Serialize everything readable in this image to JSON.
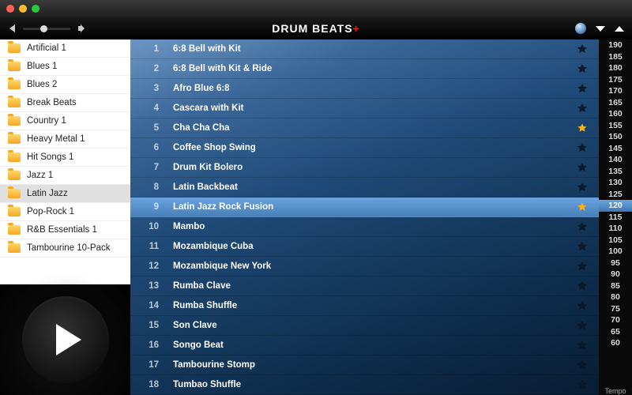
{
  "app": {
    "title": "DRUM BEATS",
    "title_suffix": "+"
  },
  "sidebar": {
    "folders": [
      {
        "label": "Artificial 1",
        "selected": false
      },
      {
        "label": "Blues 1",
        "selected": false
      },
      {
        "label": "Blues 2",
        "selected": false
      },
      {
        "label": "Break Beats",
        "selected": false
      },
      {
        "label": "Country 1",
        "selected": false
      },
      {
        "label": "Heavy Metal 1",
        "selected": false
      },
      {
        "label": "Hit Songs 1",
        "selected": false
      },
      {
        "label": "Jazz 1",
        "selected": false
      },
      {
        "label": "Latin Jazz",
        "selected": true
      },
      {
        "label": "Pop-Rock 1",
        "selected": false
      },
      {
        "label": "R&B Essentials 1",
        "selected": false
      },
      {
        "label": "Tambourine 10-Pack",
        "selected": false
      }
    ]
  },
  "tracks": [
    {
      "n": "1",
      "name": "6:8 Bell with Kit",
      "fav": false,
      "selected": false
    },
    {
      "n": "2",
      "name": "6:8 Bell with Kit & Ride",
      "fav": false,
      "selected": false
    },
    {
      "n": "3",
      "name": "Afro Blue 6:8",
      "fav": false,
      "selected": false
    },
    {
      "n": "4",
      "name": "Cascara with Kit",
      "fav": false,
      "selected": false
    },
    {
      "n": "5",
      "name": "Cha Cha Cha",
      "fav": true,
      "selected": false
    },
    {
      "n": "6",
      "name": "Coffee Shop Swing",
      "fav": false,
      "selected": false
    },
    {
      "n": "7",
      "name": "Drum Kit Bolero",
      "fav": false,
      "selected": false
    },
    {
      "n": "8",
      "name": "Latin Backbeat",
      "fav": false,
      "selected": false
    },
    {
      "n": "9",
      "name": "Latin Jazz Rock Fusion",
      "fav": true,
      "selected": true
    },
    {
      "n": "10",
      "name": "Mambo",
      "fav": false,
      "selected": false
    },
    {
      "n": "11",
      "name": "Mozambique Cuba",
      "fav": false,
      "selected": false
    },
    {
      "n": "12",
      "name": "Mozambique New York",
      "fav": false,
      "selected": false
    },
    {
      "n": "13",
      "name": "Rumba Clave",
      "fav": false,
      "selected": false
    },
    {
      "n": "14",
      "name": "Rumba Shuffle",
      "fav": false,
      "selected": false
    },
    {
      "n": "15",
      "name": "Son Clave",
      "fav": false,
      "selected": false
    },
    {
      "n": "16",
      "name": "Songo Beat",
      "fav": false,
      "selected": false
    },
    {
      "n": "17",
      "name": "Tambourine Stomp",
      "fav": false,
      "selected": false
    },
    {
      "n": "18",
      "name": "Tumbao Shuffle",
      "fav": false,
      "selected": false
    }
  ],
  "tempo": {
    "label": "Tempo",
    "selected": 120,
    "values": [
      190,
      185,
      180,
      175,
      170,
      165,
      160,
      155,
      150,
      145,
      140,
      135,
      130,
      125,
      120,
      115,
      110,
      105,
      100,
      95,
      90,
      85,
      80,
      75,
      70,
      65,
      60
    ]
  }
}
